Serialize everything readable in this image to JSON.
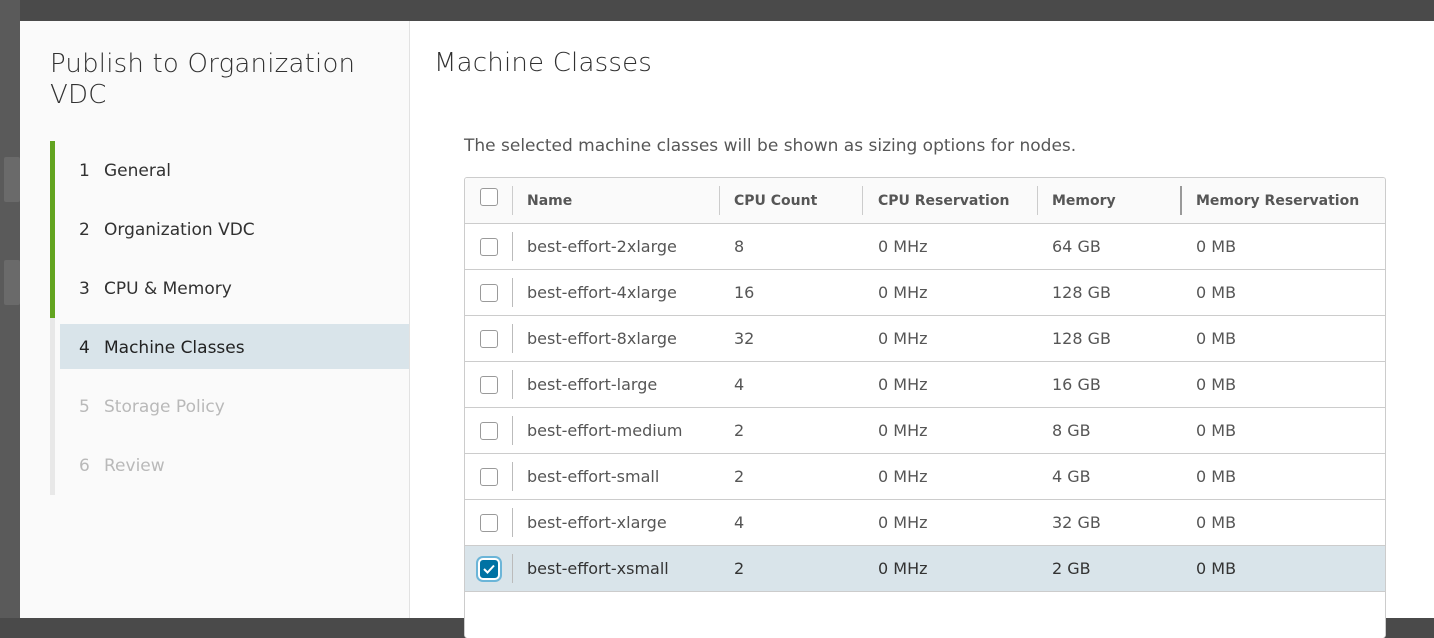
{
  "wizard": {
    "title": "Publish to Organization VDC",
    "steps": [
      {
        "num": "1",
        "label": "General",
        "state": "done"
      },
      {
        "num": "2",
        "label": "Organization VDC",
        "state": "done"
      },
      {
        "num": "3",
        "label": "CPU & Memory",
        "state": "done"
      },
      {
        "num": "4",
        "label": "Machine Classes",
        "state": "active"
      },
      {
        "num": "5",
        "label": "Storage Policy",
        "state": "pending"
      },
      {
        "num": "6",
        "label": "Review",
        "state": "pending"
      }
    ]
  },
  "page": {
    "title": "Machine Classes",
    "description": "The selected machine classes will be shown as sizing options for nodes."
  },
  "table": {
    "columns": [
      "Name",
      "CPU Count",
      "CPU Reservation",
      "Memory",
      "Memory Reservation"
    ],
    "rows": [
      {
        "name": "best-effort-2xlarge",
        "cpu": "8",
        "cpu_res": "0 MHz",
        "mem": "64 GB",
        "mem_res": "0 MB",
        "selected": false
      },
      {
        "name": "best-effort-4xlarge",
        "cpu": "16",
        "cpu_res": "0 MHz",
        "mem": "128 GB",
        "mem_res": "0 MB",
        "selected": false
      },
      {
        "name": "best-effort-8xlarge",
        "cpu": "32",
        "cpu_res": "0 MHz",
        "mem": "128 GB",
        "mem_res": "0 MB",
        "selected": false
      },
      {
        "name": "best-effort-large",
        "cpu": "4",
        "cpu_res": "0 MHz",
        "mem": "16 GB",
        "mem_res": "0 MB",
        "selected": false
      },
      {
        "name": "best-effort-medium",
        "cpu": "2",
        "cpu_res": "0 MHz",
        "mem": "8 GB",
        "mem_res": "0 MB",
        "selected": false
      },
      {
        "name": "best-effort-small",
        "cpu": "2",
        "cpu_res": "0 MHz",
        "mem": "4 GB",
        "mem_res": "0 MB",
        "selected": false
      },
      {
        "name": "best-effort-xlarge",
        "cpu": "4",
        "cpu_res": "0 MHz",
        "mem": "32 GB",
        "mem_res": "0 MB",
        "selected": false
      },
      {
        "name": "best-effort-xsmall",
        "cpu": "2",
        "cpu_res": "0 MHz",
        "mem": "2 GB",
        "mem_res": "0 MB",
        "selected": true
      }
    ]
  },
  "colors": {
    "accent": "#0072a3",
    "step_done": "#62a420",
    "selected_row": "#d9e4ea"
  }
}
